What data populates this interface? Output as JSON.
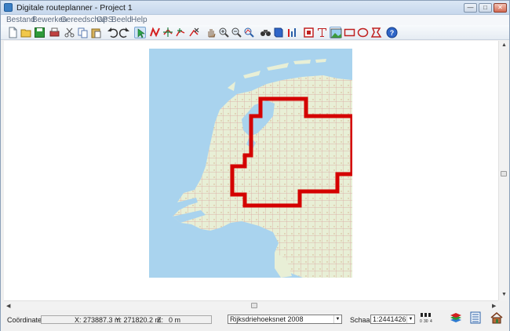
{
  "window": {
    "title": "Digitale routeplanner  - Project 1"
  },
  "menu": [
    "Bestand",
    "Bewerken",
    "Gereedschap",
    "GPS",
    "Beeld",
    "Help"
  ],
  "toolbar": {
    "icons": [
      "new-file-icon",
      "open-folder-icon",
      "save-icon",
      "print-icon",
      "cut-icon",
      "copy-icon",
      "paste-icon",
      "undo-icon",
      "redo-icon",
      "select-arrow-icon",
      "draw-route-icon",
      "add-waypoint-icon",
      "insert-waypoint-icon",
      "delete-waypoint-icon",
      "pan-hand-icon",
      "zoom-in-icon",
      "zoom-out-icon",
      "zoom-route-icon",
      "binoculars-icon",
      "book-icon",
      "info-icon",
      "image-frame-icon",
      "text-tool-icon",
      "picture-icon",
      "rectangle-tool-icon",
      "ellipse-tool-icon",
      "polygon-tool-icon",
      "help-icon"
    ]
  },
  "status": {
    "coordinates_label": "Coördinaten:",
    "x": "X: 273887.3 m",
    "y": "Y: 271820.2 m",
    "z_label": "Z:",
    "z": "0 m",
    "projection": "Rijksdriehoeksnet 2008",
    "scale_label": "Schaal:",
    "scale": "1:2441426",
    "scale_bar_ticks": [
      "0",
      "30",
      "4"
    ]
  },
  "colors": {
    "sea": "#a9d3ee",
    "land": "#e8efd6",
    "route_frame": "#d40000"
  }
}
